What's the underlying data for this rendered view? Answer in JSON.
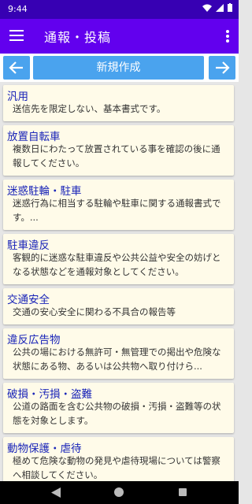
{
  "status": {
    "time": "9:44"
  },
  "appbar": {
    "title": "通報・投稿"
  },
  "toolbar": {
    "new_label": "新規作成"
  },
  "items": [
    {
      "title": "汎用",
      "desc": "送信先を限定しない、基本書式です。"
    },
    {
      "title": "放置自転車",
      "desc": "複数日にわたって放置されている事を確認の後に通報してください。"
    },
    {
      "title": "迷惑駐輪・駐車",
      "desc": "迷惑行為に相当する駐輪や駐車に関する通報書式です。..."
    },
    {
      "title": "駐車違反",
      "desc": "客観的に迷惑な駐車違反や公共公益や安全の妨げとなる状態などを通報対象としてください。"
    },
    {
      "title": "交通安全",
      "desc": "交通の安心安全に関わる不具合の報告等"
    },
    {
      "title": "違反広告物",
      "desc": "公共の場における無許可・無管理での掲出や危険な状態にある物、あるいは公共物へ取り付けら..."
    },
    {
      "title": "破損・汚損・盗難",
      "desc": "公道の路面を含む公共物の破損・汚損・盗難等の状態を対象とします。"
    },
    {
      "title": "動物保護・虐待",
      "desc": "極めて危険な動物の発見や虐待現場については警察へ相談してください。"
    }
  ]
}
